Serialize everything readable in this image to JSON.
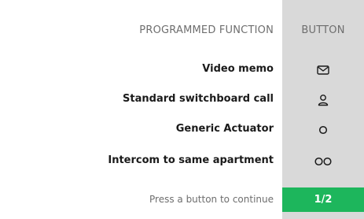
{
  "header": {
    "function_label": "PROGRAMMED FUNCTION",
    "button_label": "BUTTON"
  },
  "rows": [
    {
      "label": "Video memo",
      "icon": "envelope-icon"
    },
    {
      "label": "Standard switchboard call",
      "icon": "concierge-icon"
    },
    {
      "label": "Generic Actuator",
      "icon": "single-circle-icon"
    },
    {
      "label": "Intercom to same apartment",
      "icon": "double-circle-icon"
    }
  ],
  "footer": {
    "instruction": "Press a button to continue",
    "page_indicator": "1/2"
  },
  "colors": {
    "button_column_bg": "#d9d9d9",
    "accent_green": "#1db65c",
    "muted_text": "#6e6e6e",
    "primary_text": "#1a1a1a"
  }
}
